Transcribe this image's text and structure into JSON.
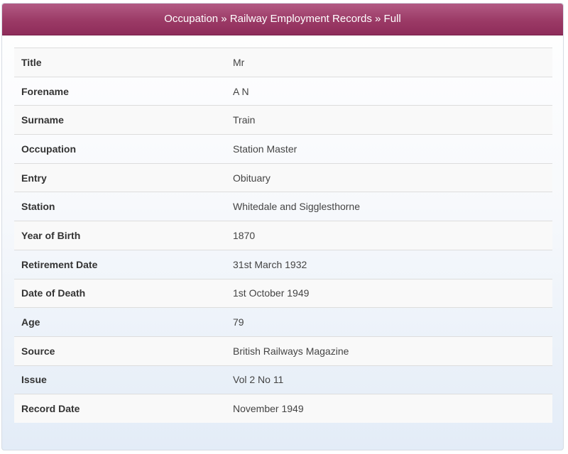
{
  "header": {
    "breadcrumb": "Occupation » Railway Employment Records » Full"
  },
  "record": {
    "rows": [
      {
        "label": "Title",
        "value": "Mr"
      },
      {
        "label": "Forename",
        "value": "A N"
      },
      {
        "label": "Surname",
        "value": "Train"
      },
      {
        "label": "Occupation",
        "value": "Station Master"
      },
      {
        "label": "Entry",
        "value": "Obituary"
      },
      {
        "label": "Station",
        "value": "Whitedale and Sigglesthorne"
      },
      {
        "label": "Year of Birth",
        "value": "1870"
      },
      {
        "label": "Retirement Date",
        "value": "31st March 1932"
      },
      {
        "label": "Date of Death",
        "value": "1st October 1949"
      },
      {
        "label": "Age",
        "value": "79"
      },
      {
        "label": "Source",
        "value": "British Railways Magazine"
      },
      {
        "label": "Issue",
        "value": "Vol 2 No 11"
      },
      {
        "label": "Record Date",
        "value": "November 1949"
      }
    ]
  },
  "colors": {
    "header_background": "#9b3a66",
    "header_text": "#ffffff",
    "panel_gradient_bottom": "#e3ecf7"
  }
}
